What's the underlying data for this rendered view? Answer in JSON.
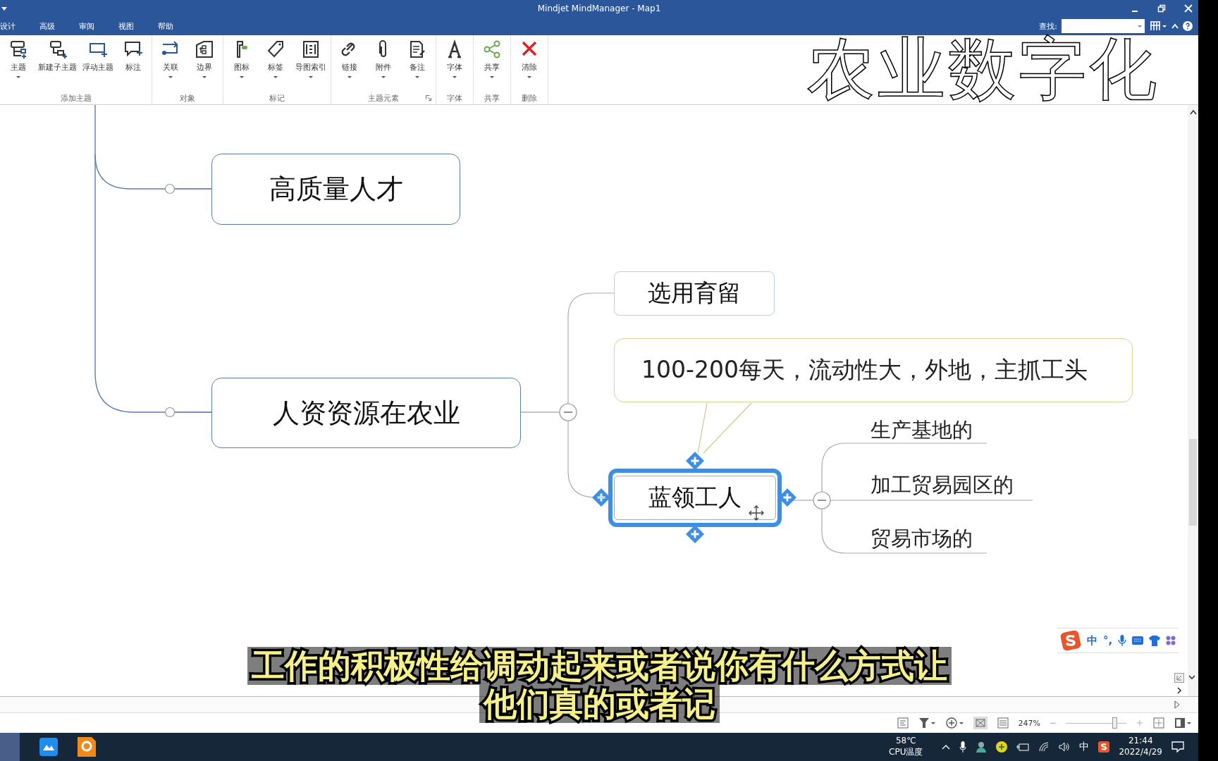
{
  "window": {
    "title": "Mindjet MindManager - Map1"
  },
  "menu_tabs": [
    {
      "label": "设计",
      "selected": false
    },
    {
      "label": "高级",
      "selected": false
    },
    {
      "label": "审阅",
      "selected": false
    },
    {
      "label": "视图",
      "selected": false
    },
    {
      "label": "帮助",
      "selected": false
    }
  ],
  "search": {
    "label": "查找:"
  },
  "ribbon_groups": [
    {
      "label": "添加主题",
      "buttons": [
        {
          "label": "主题",
          "dropdown": true
        },
        {
          "label": "新建子主题",
          "dropdown": false
        },
        {
          "label": "浮动主题",
          "dropdown": false
        },
        {
          "label": "标注",
          "dropdown": false
        }
      ]
    },
    {
      "label": "对象",
      "buttons": [
        {
          "label": "关联",
          "dropdown": true
        },
        {
          "label": "边界",
          "dropdown": true
        }
      ]
    },
    {
      "label": "标记",
      "buttons": [
        {
          "label": "图标",
          "dropdown": true
        },
        {
          "label": "标签",
          "dropdown": true
        },
        {
          "label": "导图索引",
          "dropdown": true
        }
      ]
    },
    {
      "label": "主题元素",
      "launcher": true,
      "buttons": [
        {
          "label": "链接",
          "dropdown": true
        },
        {
          "label": "附件",
          "dropdown": true
        },
        {
          "label": "备注",
          "dropdown": true
        }
      ]
    },
    {
      "label": "字体",
      "buttons": [
        {
          "label": "字体",
          "dropdown": true
        }
      ]
    },
    {
      "label": "共享",
      "buttons": [
        {
          "label": "共享",
          "dropdown": true
        }
      ]
    },
    {
      "label": "删除",
      "buttons": [
        {
          "label": "清除",
          "dropdown": true
        }
      ]
    }
  ],
  "overlay_title": "农业数字化",
  "map": {
    "topics": [
      {
        "label": "高质量人才",
        "selected": false
      },
      {
        "label": "人资资源在农业",
        "selected": false,
        "children": [
          {
            "label": "选用育留",
            "selected": false
          },
          {
            "label": "蓝领工人",
            "selected": true,
            "callout": "100-200每天，流动性大，外地，主抓工头",
            "children": [
              {
                "label": "生产基地的"
              },
              {
                "label": "加工贸易园区的"
              },
              {
                "label": "贸易市场的"
              }
            ]
          }
        ]
      }
    ]
  },
  "subtitles": [
    "工作的积极性给调动起来或者说你有什么方式让",
    "他们真的或者记"
  ],
  "ime_toolbar": {
    "language": "中",
    "punctuation": "°,"
  },
  "status_bar": {
    "zoom": "247%",
    "zoom_slider": {
      "level": 0.8
    }
  },
  "taskbar": {
    "temperature": "58℃",
    "temperature_label": "CPU温度",
    "ime": "中",
    "time": "21:44",
    "date": "2022/4/29"
  }
}
